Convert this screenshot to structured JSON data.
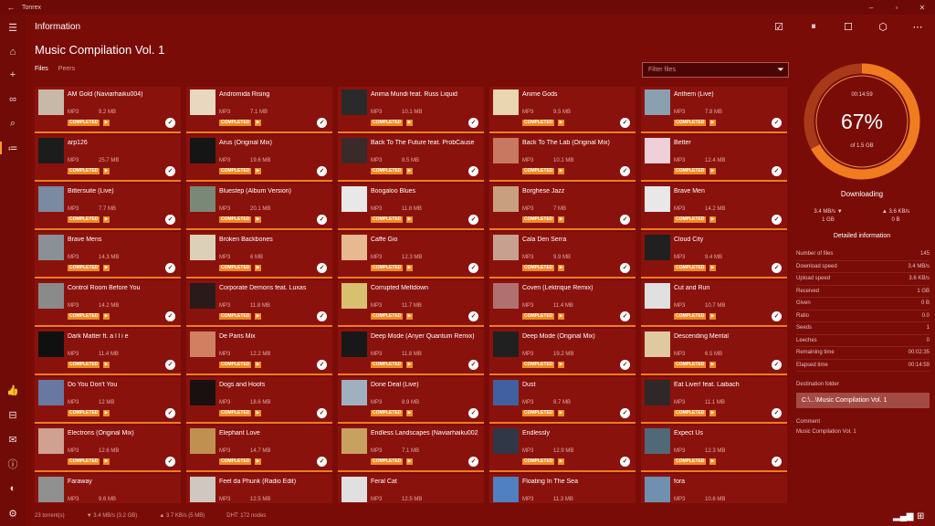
{
  "app": {
    "name": "Tonrex"
  },
  "header": {
    "title": "Information"
  },
  "page": {
    "title": "Music Compilation Vol. 1"
  },
  "tabs": [
    {
      "label": "Files"
    },
    {
      "label": "Peers"
    }
  ],
  "filter": {
    "placeholder": "Filter files"
  },
  "badge_label": "COMPLETED",
  "colors": {
    "background": "#7a0c08",
    "card": "#8a120d",
    "accent": "#f07c1f"
  },
  "files": [
    {
      "name": "AM Gold (Naviarhaiku004)",
      "type": "MP3",
      "size": "9.2 MB"
    },
    {
      "name": "Andromida Rising",
      "type": "MP3",
      "size": "7.1 MB"
    },
    {
      "name": "Anima Mundi feat. Russ Liquid",
      "type": "MP3",
      "size": "10.1 MB"
    },
    {
      "name": "Anime Gods",
      "type": "MP3",
      "size": "9.5 MB"
    },
    {
      "name": "Anthem (Live)",
      "type": "MP3",
      "size": "7.8 MB"
    },
    {
      "name": "arp126",
      "type": "MP3",
      "size": "25.7 MB"
    },
    {
      "name": "Arus (Original Mix)",
      "type": "MP3",
      "size": "19.6 MB"
    },
    {
      "name": "Back To The Future feat. ProbCause",
      "type": "MP3",
      "size": "8.5 MB"
    },
    {
      "name": "Back To The Lab (Original Mix)",
      "type": "MP3",
      "size": "10.1 MB"
    },
    {
      "name": "Better",
      "type": "MP3",
      "size": "12.4 MB"
    },
    {
      "name": "Bittersuite (Live)",
      "type": "MP3",
      "size": "7.7 MB"
    },
    {
      "name": "Bluestep (Album Version)",
      "type": "MP3",
      "size": "20.1 MB"
    },
    {
      "name": "Boogaloo Blues",
      "type": "MP3",
      "size": "11.8 MB"
    },
    {
      "name": "Borghese Jazz",
      "type": "MP3",
      "size": "7 MB"
    },
    {
      "name": "Brave Men",
      "type": "MP3",
      "size": "14.2 MB"
    },
    {
      "name": "Brave Mens",
      "type": "MP3",
      "size": "14.3 MB"
    },
    {
      "name": "Broken Backbones",
      "type": "MP3",
      "size": "6 MB"
    },
    {
      "name": "Caffe Gio",
      "type": "MP3",
      "size": "12.3 MB"
    },
    {
      "name": "Cala Den Serra",
      "type": "MP3",
      "size": "9.9 MB"
    },
    {
      "name": "Cloud City",
      "type": "MP3",
      "size": "9.4 MB"
    },
    {
      "name": "Control Room Before You",
      "type": "MP3",
      "size": "14.2 MB"
    },
    {
      "name": "Corporate Demons feat. Luxas",
      "type": "MP3",
      "size": "11.8 MB"
    },
    {
      "name": "Corrupted Meltdown",
      "type": "MP3",
      "size": "11.7 MB"
    },
    {
      "name": "Coven (Lektrique Remix)",
      "type": "MP3",
      "size": "11.4 MB"
    },
    {
      "name": "Cut and Run",
      "type": "MP3",
      "size": "10.7 MB"
    },
    {
      "name": "Dark Matter ft. a l l i e",
      "type": "MP3",
      "size": "11.4 MB"
    },
    {
      "name": "De Paris Mix",
      "type": "MP3",
      "size": "12.2 MB"
    },
    {
      "name": "Deep Mode (Anyer Quantum Remix)",
      "type": "MP3",
      "size": "11.8 MB"
    },
    {
      "name": "Deep Mode (Original Mix)",
      "type": "MP3",
      "size": "19.2 MB"
    },
    {
      "name": "Descending Mental",
      "type": "MP3",
      "size": "6.5 MB"
    },
    {
      "name": "Do You Don't You",
      "type": "MP3",
      "size": "12 MB"
    },
    {
      "name": "Dogs and Hoofs",
      "type": "MP3",
      "size": "18.6 MB"
    },
    {
      "name": "Done Deal (Live)",
      "type": "MP3",
      "size": "8.9 MB"
    },
    {
      "name": "Dust",
      "type": "MP3",
      "size": "8.7 MB"
    },
    {
      "name": "Eat Liver! feat. Laibach",
      "type": "MP3",
      "size": "11.1 MB"
    },
    {
      "name": "Electrons (Original Mix)",
      "type": "MP3",
      "size": "12.6 MB"
    },
    {
      "name": "Elephant Love",
      "type": "MP3",
      "size": "14.7 MB"
    },
    {
      "name": "Endless Landscapes (Naviarhaiku002)",
      "type": "MP3",
      "size": "7.1 MB"
    },
    {
      "name": "Endlessly",
      "type": "MP3",
      "size": "12.9 MB"
    },
    {
      "name": "Expect Us",
      "type": "MP3",
      "size": "12.3 MB"
    },
    {
      "name": "Faraway",
      "type": "MP3",
      "size": "9.6 MB"
    },
    {
      "name": "Feel da Phunk (Radio Edit)",
      "type": "MP3",
      "size": "12.5 MB"
    },
    {
      "name": "Feral Cat",
      "type": "MP3",
      "size": "12.5 MB"
    },
    {
      "name": "Floating In The Sea",
      "type": "MP3",
      "size": "11.3 MB"
    },
    {
      "name": "fora",
      "type": "MP3",
      "size": "10.6 MB"
    }
  ],
  "thumb_colors": [
    "#c8b8a8",
    "#e8d8c0",
    "#2a2a2a",
    "#ead6b0",
    "#8aa0b0",
    "#1c1c1c",
    "#151515",
    "#3a2a2a",
    "#c87860",
    "#f0d0d8",
    "#7a8aa0",
    "#7a8878",
    "#e8e8e8",
    "#c8a080",
    "#e8e8e8",
    "#8a9098",
    "#ddd0b8",
    "#e8b890",
    "#c8a090",
    "#202020",
    "#8a8a8a",
    "#2a1a1a",
    "#d8c070",
    "#b07070",
    "#e0e0e0",
    "#101010",
    "#d08060",
    "#181818",
    "#202020",
    "#e0c8a0",
    "#6878a0",
    "#1a1010",
    "#a0b0c0",
    "#4060a0",
    "#302828",
    "#d0a090",
    "#c09050",
    "#c8a060",
    "#303848",
    "#506878",
    "#909090",
    "#d0c8c0",
    "#e0e0e0",
    "#5080c0",
    "#7090b0"
  ],
  "stats": {
    "elapsed": "00:14:59",
    "percent": "67%",
    "progress": 0.67,
    "of_size": "of 1.5 GB",
    "status": "Downloading",
    "down_speed": "3.4 MB/s ▼",
    "down_total": "1 GB",
    "up_speed": "▲ 3.6 KB/s",
    "up_total": "0 B"
  },
  "details_title": "Detailed information",
  "details": [
    {
      "label": "Number of files",
      "value": "145"
    },
    {
      "label": "Download speed",
      "value": "3.4 MB/s"
    },
    {
      "label": "Upload speed",
      "value": "3.6 KB/s"
    },
    {
      "label": "Received",
      "value": "1 GB"
    },
    {
      "label": "Given",
      "value": "0 B"
    },
    {
      "label": "Ratio",
      "value": "0.0"
    },
    {
      "label": "Seeds",
      "value": "1"
    },
    {
      "label": "Leeches",
      "value": "0"
    },
    {
      "label": "Remaining time",
      "value": "00:02:35"
    },
    {
      "label": "Elapsed time",
      "value": "00:14:59"
    }
  ],
  "destination": {
    "label": "Destination folder",
    "value": "C:\\...\\Music Compilation Vol. 1"
  },
  "comment": {
    "label": "Comment",
    "value": "Music Compilation Vol. 1"
  },
  "statusbar": {
    "torrents": "23 torrent(s)",
    "down": "▼ 3.4 MB/s (3.2 GB)",
    "up": "▲ 3.7 KB/s (5 MB)",
    "dht": "DHT: 172 nodes"
  }
}
